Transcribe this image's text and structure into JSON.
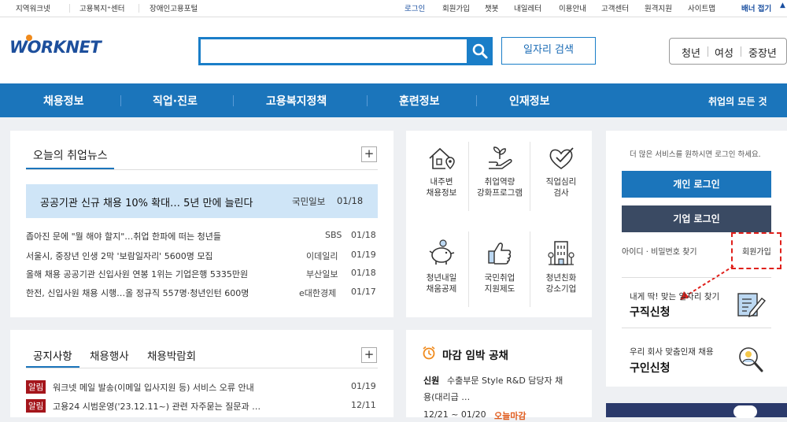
{
  "topbar": {
    "left_links": [
      "지역워크넷",
      "고용복지⁺센터",
      "장애인고용포털"
    ],
    "right_links": [
      "로그인",
      "회원가입",
      "챗봇",
      "내일레터",
      "이용안내",
      "고객센터",
      "원격지원",
      "사이트맵"
    ],
    "banner": "배너 접기"
  },
  "header": {
    "logo": "WORKNET",
    "search_placeholder": "",
    "job_search_button": "일자리 검색",
    "quick_links": [
      "청년",
      "여성",
      "중장년"
    ]
  },
  "nav": {
    "items": [
      "채용정보",
      "직업·진로",
      "고용복지정책",
      "훈련정보",
      "인재정보"
    ],
    "all": "취업의 모든 것"
  },
  "news": {
    "title": "오늘의 취업뉴스",
    "headline": {
      "text": "공공기관 신규 채용 10% 확대… 5년 만에 늘린다",
      "source": "국민일보",
      "date": "01/18"
    },
    "items": [
      {
        "text": "좁아진 문에 \"뭘 해야 할지\"…취업 한파에 떠는 청년들",
        "source": "SBS",
        "date": "01/18"
      },
      {
        "text": "서울시, 중장년 인생 2막 '보람일자리' 5600명 모집",
        "source": "이데일리",
        "date": "01/19"
      },
      {
        "text": "올해 채용 공공기관 신입사원 연봉 1위는 기업은행 5335만원",
        "source": "부산일보",
        "date": "01/18"
      },
      {
        "text": "한전, 신입사원 채용 시행…올 정규직 557명·청년인턴 600명",
        "source": "e대한경제",
        "date": "01/17"
      }
    ]
  },
  "services": [
    {
      "line1": "내주변",
      "line2": "채용정보",
      "icon": "house-location-icon"
    },
    {
      "line1": "취업역량",
      "line2": "강화프로그램",
      "icon": "plant-hand-icon"
    },
    {
      "line1": "직업심리",
      "line2": "검사",
      "icon": "heart-check-icon"
    },
    {
      "line1": "청년내일",
      "line2": "채움공제",
      "icon": "piggy-bank-icon"
    },
    {
      "line1": "국민취업",
      "line2": "지원제도",
      "icon": "thumbs-up-icon"
    },
    {
      "line1": "청년친화",
      "line2": "강소기업",
      "icon": "building-icon"
    }
  ],
  "login": {
    "prompt": "더 많은 서비스를 원하시면 로그인 하세요.",
    "personal": "개인 로그인",
    "company": "기업 로그인",
    "find": "아이디 · 비밀번호 찾기",
    "signup": "회원가입",
    "job_seek_sub": "내게 딱! 맞는 일자리 찾기",
    "job_seek": "구직신청",
    "recruit_sub": "우리 회사 맞춤인재 채용",
    "recruit": "구인신청"
  },
  "notice": {
    "tabs": [
      "공지사항",
      "채용행사",
      "채용박람회"
    ],
    "badge": "알림",
    "items": [
      {
        "text": "워크넷 메일 발송(이메일 입사지원 등) 서비스 오류 안내",
        "date": "01/19"
      },
      {
        "text": "고용24 시범운영('23.12.11~) 관련 자주묻는 질문과 …",
        "date": "12/11"
      }
    ]
  },
  "deadline": {
    "title": "마감 임박 공채",
    "company": "신원",
    "desc_line1": "수출부문 Style R&D 담당자 채",
    "desc_line2": "용(대리급 …",
    "period": "12/21 ~ 01/20",
    "status": "오늘마감"
  },
  "colors": {
    "nav": "#1b75bb",
    "login_personal": "#1b75bb",
    "login_company": "#3a4a63",
    "badge": "#a4151b",
    "annotation": "#e0201b"
  }
}
